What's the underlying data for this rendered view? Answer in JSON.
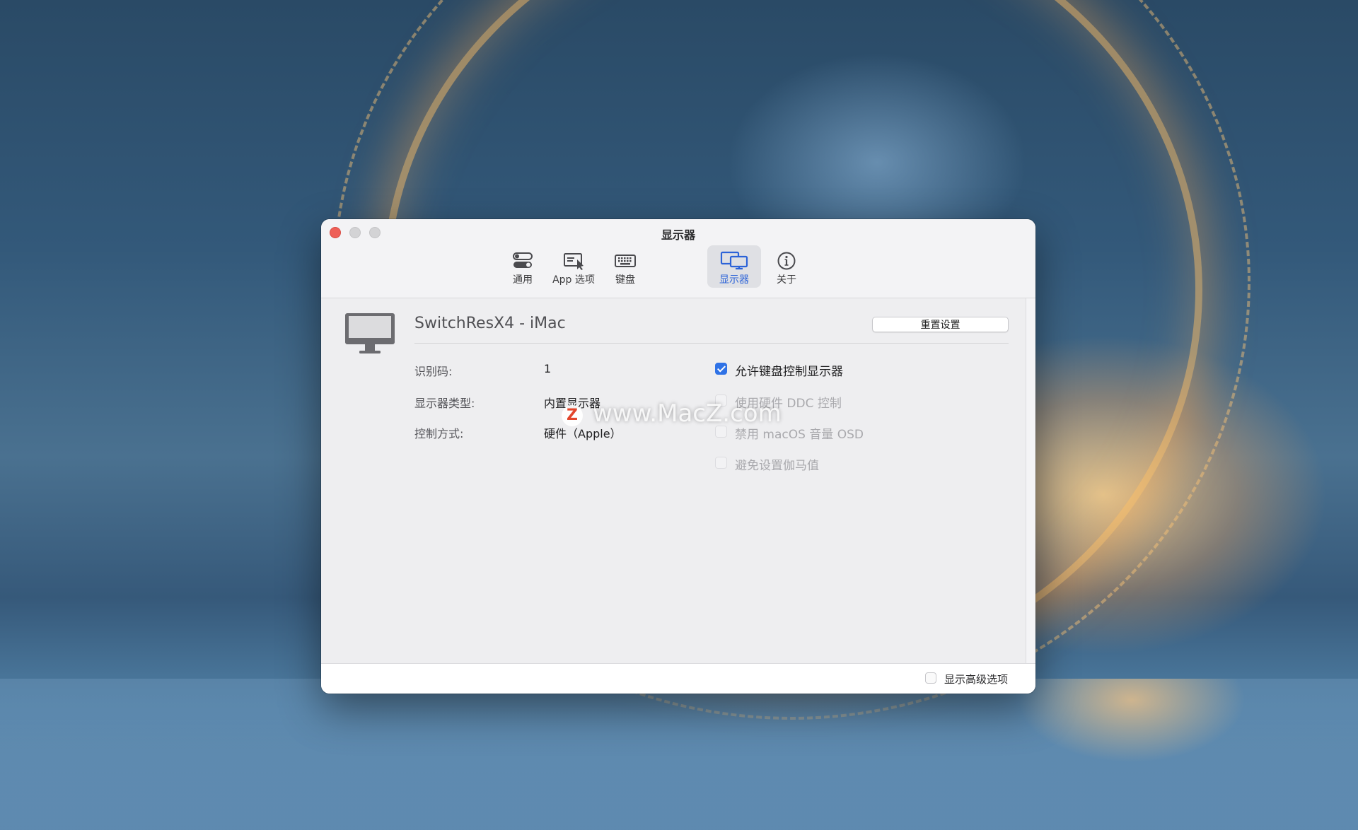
{
  "window": {
    "title": "显示器"
  },
  "toolbar": {
    "items": [
      {
        "label": "通用",
        "icon": "toggle-icon",
        "active": false
      },
      {
        "label": "App 选项",
        "icon": "app-window-cursor-icon",
        "active": false
      },
      {
        "label": "键盘",
        "icon": "keyboard-icon",
        "active": false
      },
      {
        "label": "显示器",
        "icon": "displays-icon",
        "active": true
      },
      {
        "label": "关于",
        "icon": "info-icon",
        "active": false
      }
    ]
  },
  "display": {
    "icon": "imac-icon",
    "name": "SwitchResX4 - iMac",
    "reset_label": "重置设置",
    "fields": [
      {
        "key": "识别码:",
        "value": "1"
      },
      {
        "key": "显示器类型:",
        "value": "内置显示器"
      },
      {
        "key": "控制方式:",
        "value": "硬件（Apple）"
      }
    ],
    "options": [
      {
        "label": "允许键盘控制显示器",
        "checked": true,
        "enabled": true
      },
      {
        "label": "使用硬件 DDC 控制",
        "checked": false,
        "enabled": false
      },
      {
        "label": "禁用 macOS 音量 OSD",
        "checked": false,
        "enabled": false
      },
      {
        "label": "避免设置伽马值",
        "checked": false,
        "enabled": false
      }
    ]
  },
  "watermark": {
    "logo": "Z",
    "text": "www.MacZ.com"
  },
  "footer": {
    "advanced_label": "显示高级选项",
    "advanced_checked": false
  },
  "colors": {
    "accent": "#2f72e6",
    "close": "#ee5f57"
  }
}
